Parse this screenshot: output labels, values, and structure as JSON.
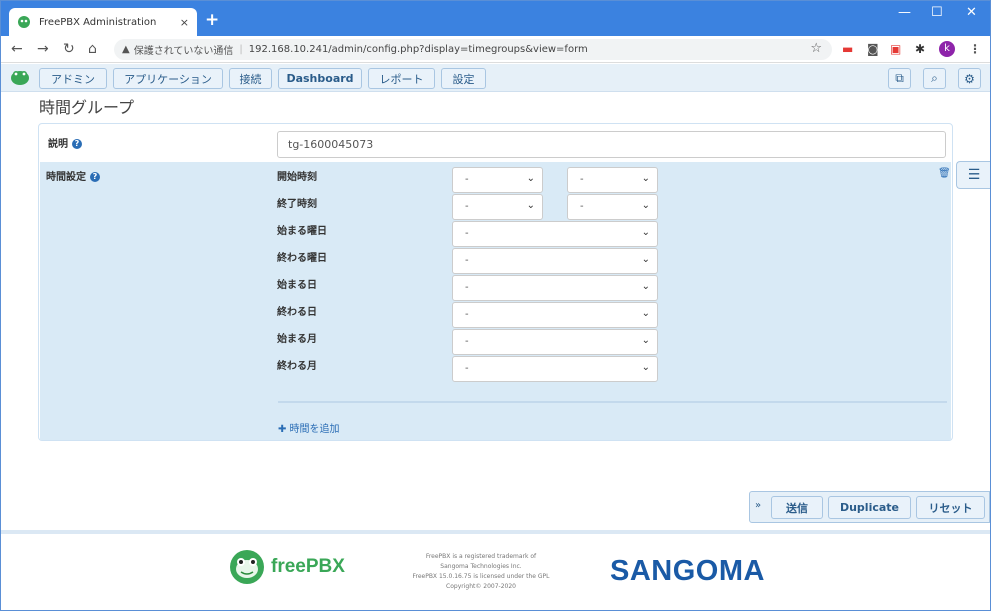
{
  "browser": {
    "tab_title": "FreePBX Administration",
    "tab_close": "×",
    "new_tab": "+",
    "win_min": "—",
    "win_max": "☐",
    "win_close": "✕",
    "nav": {
      "back": "←",
      "forward": "→",
      "reload": "↻",
      "home": "⌂"
    },
    "security_warning_icon": "▲",
    "security_text": "保護されていない通信",
    "separator": "|",
    "url": "192.168.10.241/admin/config.php?display=timegroups&view=form",
    "star": "☆",
    "profile_initial": "k"
  },
  "pbx_nav": {
    "items": [
      "アドミン",
      "アプリケーション",
      "接続",
      "Dashboard",
      "レポート",
      "設定"
    ]
  },
  "page": {
    "title": "時間グループ",
    "description_label": "説明",
    "description_value": "tg-1600045073",
    "time_settings_label": "時間設定",
    "help_glyph": "?",
    "rows": [
      {
        "label": "開始時刻",
        "selects": [
          "-",
          "-"
        ]
      },
      {
        "label": "終了時刻",
        "selects": [
          "-",
          "-"
        ]
      },
      {
        "label": "始まる曜日",
        "selects": [
          "-"
        ]
      },
      {
        "label": "終わる曜日",
        "selects": [
          "-"
        ]
      },
      {
        "label": "始まる日",
        "selects": [
          "-"
        ]
      },
      {
        "label": "終わる日",
        "selects": [
          "-"
        ]
      },
      {
        "label": "始まる月",
        "selects": [
          "-"
        ]
      },
      {
        "label": "終わる月",
        "selects": [
          "-"
        ]
      }
    ],
    "add_time": "✚ 時間を追加",
    "trash_icon": "🗑"
  },
  "actions": {
    "collapse": "»",
    "submit": "送信",
    "duplicate": "Duplicate",
    "reset": "リセット"
  },
  "footer": {
    "freepbx_logo_text": "freePBX",
    "legal_lines": [
      "FreePBX is a registered trademark of",
      "Sangoma Technologies Inc.",
      "FreePBX 15.0.16.75 is licensed under the GPL",
      "Copyright© 2007-2020"
    ],
    "sangoma_logo_text": "SANGOMA"
  },
  "colors": {
    "tabstrip": "#3b82e0",
    "nav_bg": "#e6f0f8",
    "section_bg": "#d9eaf6",
    "link": "#2a6db5",
    "sangoma_blue": "#1a5aa6",
    "sangoma_orange": "#f28c1c",
    "freepbx_green": "#3aa757"
  }
}
